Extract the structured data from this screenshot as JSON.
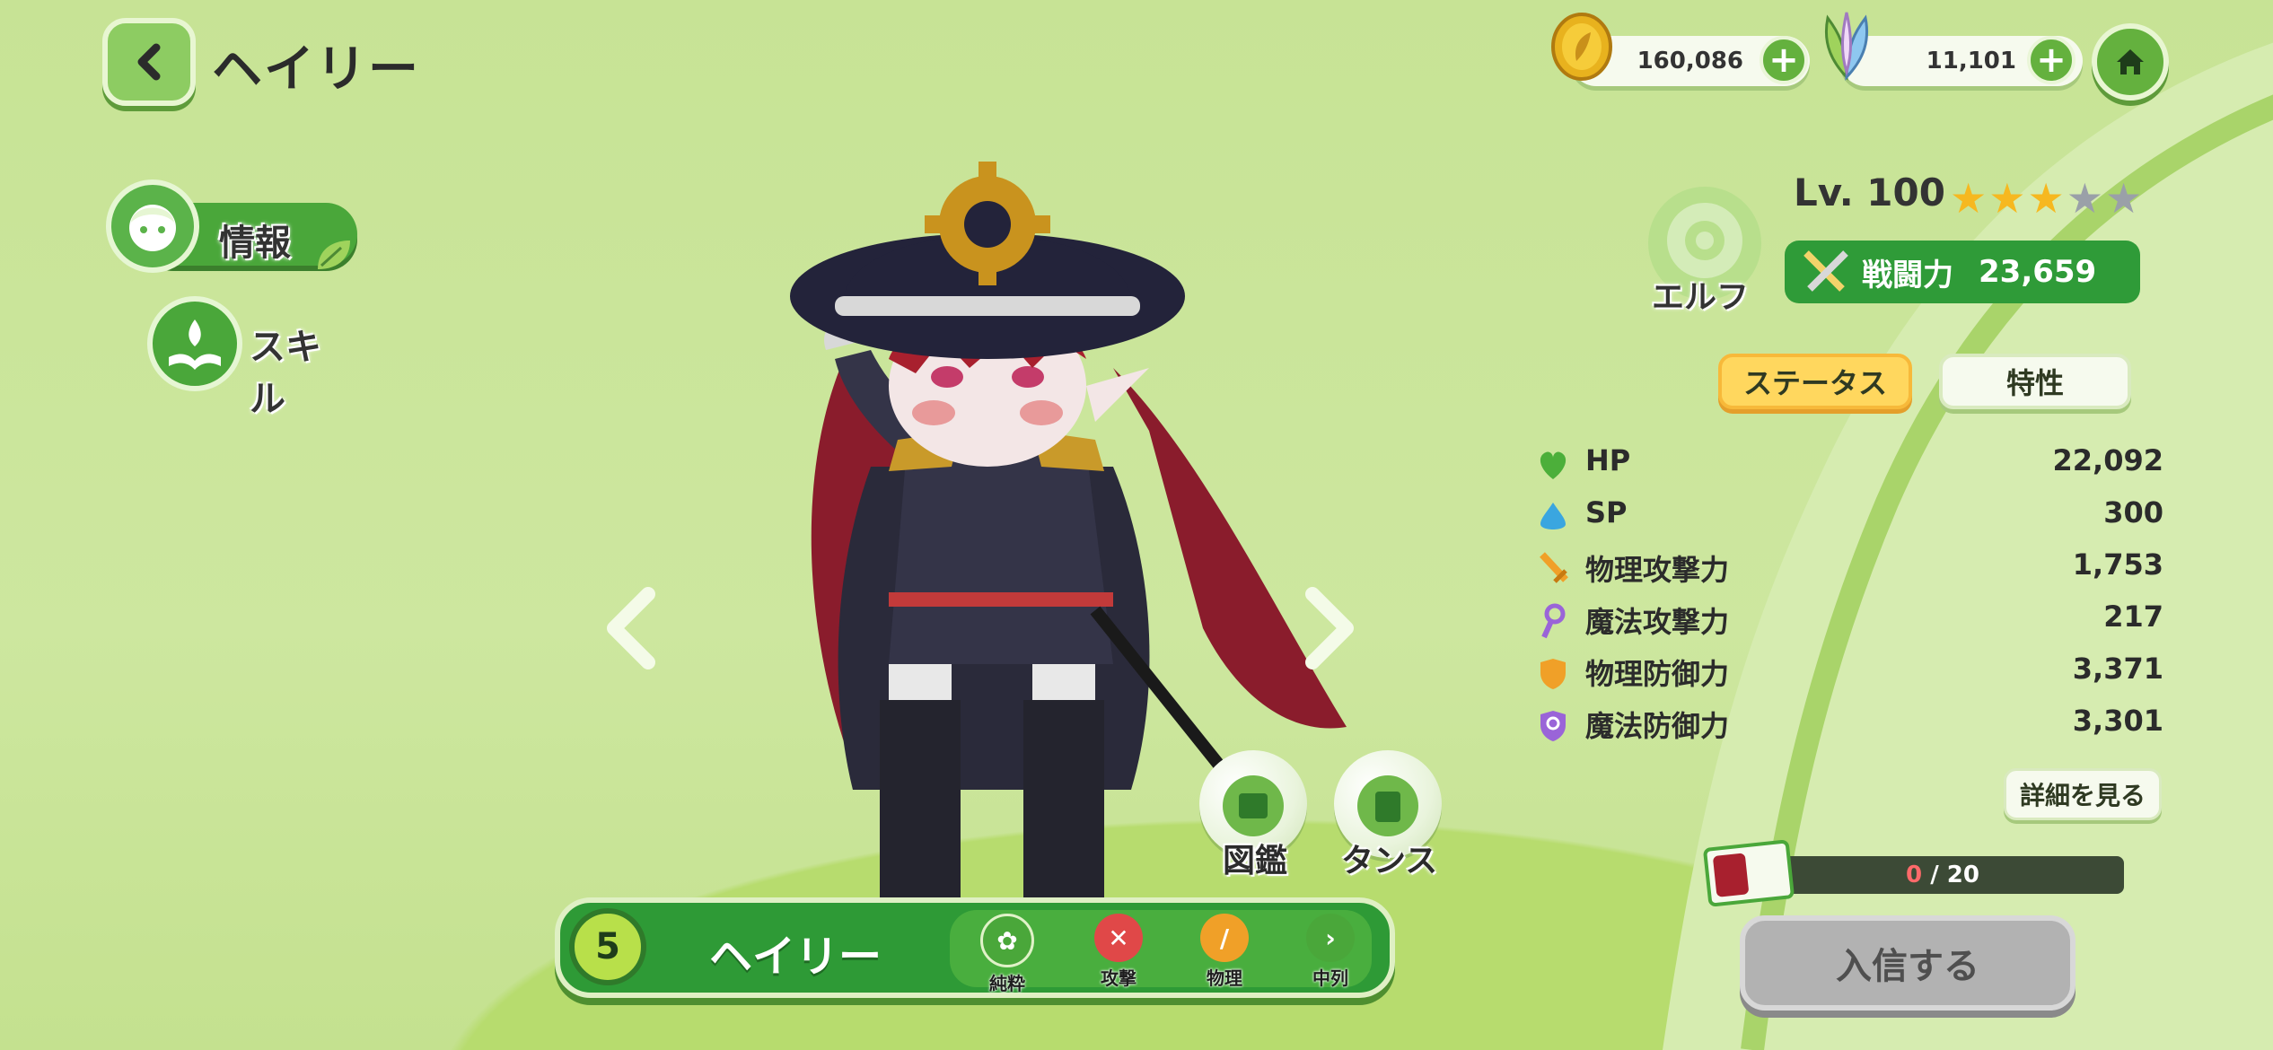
{
  "header": {
    "back_icon": "chevron-left-icon",
    "title": "ヘイリー",
    "gold_amount": "160,086",
    "gem_amount": "11,101",
    "home_icon": "home-icon"
  },
  "side_menu": {
    "info_label": "情報",
    "skill_label": "スキル"
  },
  "character": {
    "level": "Lv. 100",
    "stars_filled": 3,
    "stars_total": 5,
    "race": "エルフ",
    "power_label": "戦闘力",
    "power_value": "23,659",
    "rank": "5",
    "name": "ヘイリー",
    "tags": [
      "純粋",
      "攻撃",
      "物理",
      "中列"
    ]
  },
  "tabs": {
    "status": "ステータス",
    "traits": "特性"
  },
  "stats": [
    {
      "label": "HP",
      "value": "22,092",
      "icon": "heart-icon",
      "color": "#4caf3a"
    },
    {
      "label": "SP",
      "value": "300",
      "icon": "drop-icon",
      "color": "#3aa6e0"
    },
    {
      "label": "物理攻撃力",
      "value": "1,753",
      "icon": "sword-icon",
      "color": "#f0a028"
    },
    {
      "label": "魔法攻撃力",
      "value": "217",
      "icon": "wand-icon",
      "color": "#9a64d8"
    },
    {
      "label": "物理防御力",
      "value": "3,371",
      "icon": "shield-icon",
      "color": "#f0a028"
    },
    {
      "label": "魔法防御力",
      "value": "3,301",
      "icon": "magic-shield-icon",
      "color": "#9a64d8"
    }
  ],
  "buttons": {
    "detail": "詳細を見る",
    "encyclopedia": "図鑑",
    "dresser": "タンス",
    "recruit": "入信する"
  },
  "progress": {
    "current": "0",
    "total": "20",
    "text_sep": " / "
  },
  "colors": {
    "accent_green": "#2e9a36",
    "tab_active": "#ffd75e",
    "recruit_disabled": "#b2b2b2"
  }
}
